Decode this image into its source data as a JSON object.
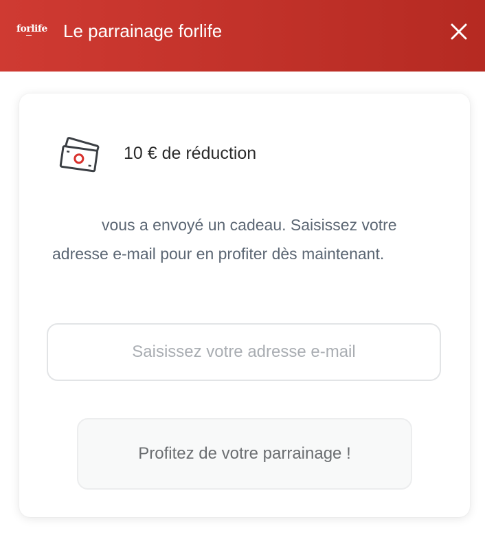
{
  "header": {
    "logo_text": "forlife",
    "title": "Le parrainage forlife",
    "close_icon": "close-icon"
  },
  "offer": {
    "icon": "money-bill-icon",
    "reward": "10 € de réduction"
  },
  "message": "vous a envoyé un cadeau. Saisissez votre adresse e-mail pour en profiter dès maintenant.",
  "email": {
    "value": "",
    "placeholder": "Saisissez votre adresse e-mail"
  },
  "cta": {
    "label": "Profitez de votre parrainage !"
  },
  "colors": {
    "header_start": "#cf3a32",
    "header_end": "#b52a22",
    "accent_red": "#d8312c",
    "text_body": "#5b6673"
  }
}
